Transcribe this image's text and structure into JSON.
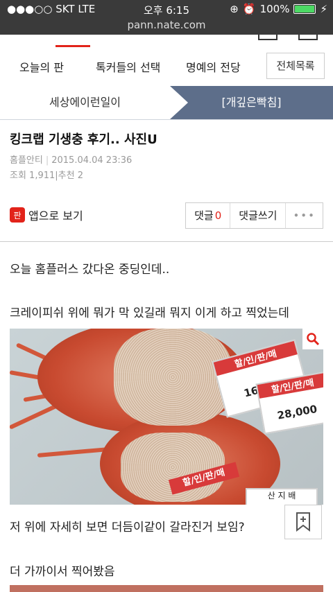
{
  "status": {
    "carrier": "●●●○○ SKT   LTE",
    "time": "오후 6:15",
    "battery_text": "100%",
    "battery_level": 1.0
  },
  "url": "pann.nate.com",
  "nav": {
    "items": [
      "오늘의 판",
      "톡커들의 선택",
      "명예의 전당"
    ],
    "all_label": "전체목록"
  },
  "subnav": {
    "left": "세상에이런일이",
    "right": "[개깊은빡침]"
  },
  "article": {
    "title": "킹크랩 기생충 후기.. 사진U",
    "author": "홈플안티",
    "date": "2015.04.04 23:36",
    "views": "조회 1,911",
    "recommend": "추천 2"
  },
  "actions": {
    "app_label": "앱으로 보기",
    "app_icon": "판",
    "comment_label": "댓글",
    "comment_count": "0",
    "write_label": "댓글쓰기",
    "more": "•••"
  },
  "body": {
    "p1": "오늘 홈플러스 갔다온 중딩인데..",
    "p2": "크레이피쉬 위에 뭐가 막 있길래 뭐지 이게 하고 찍었는데",
    "p3": "저 위에 자세히 보면 더듬이같이 갈라진거 보임?",
    "p4": "더 가까이서 찍어봤음"
  },
  "photo_labels": {
    "price1": "16,000",
    "price2": "28,000",
    "sale1": "할/인/판/매",
    "sale2": "할/인/판/매",
    "sale3": "할/인/판/매",
    "sticker": "산 지 배"
  },
  "colors": {
    "accent": "#e2231a",
    "subnav_active": "#5d6e8a"
  }
}
